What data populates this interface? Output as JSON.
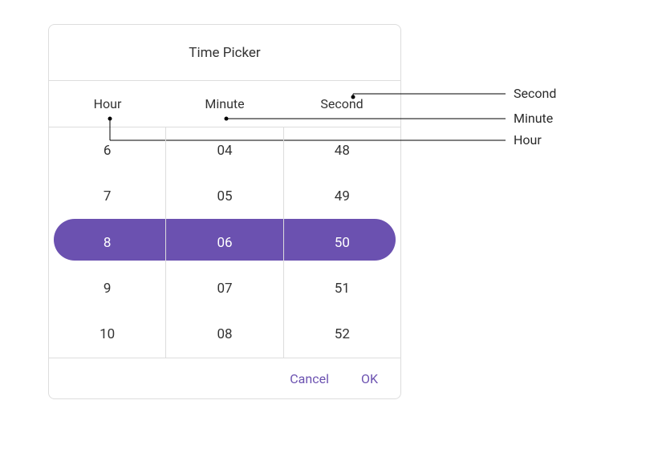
{
  "title": "Time Picker",
  "headers": {
    "hour": "Hour",
    "minute": "Minute",
    "second": "Second"
  },
  "columns": {
    "hour": {
      "items": [
        "6",
        "7",
        "8",
        "9",
        "10"
      ],
      "selectedIndex": 2
    },
    "minute": {
      "items": [
        "04",
        "05",
        "06",
        "07",
        "08"
      ],
      "selectedIndex": 2
    },
    "second": {
      "items": [
        "48",
        "49",
        "50",
        "51",
        "52"
      ],
      "selectedIndex": 2
    }
  },
  "footer": {
    "cancel": "Cancel",
    "ok": "OK"
  },
  "annotations": {
    "second": "Second",
    "minute": "Minute",
    "hour": "Hour"
  },
  "colors": {
    "accent": "#6b51b0"
  }
}
